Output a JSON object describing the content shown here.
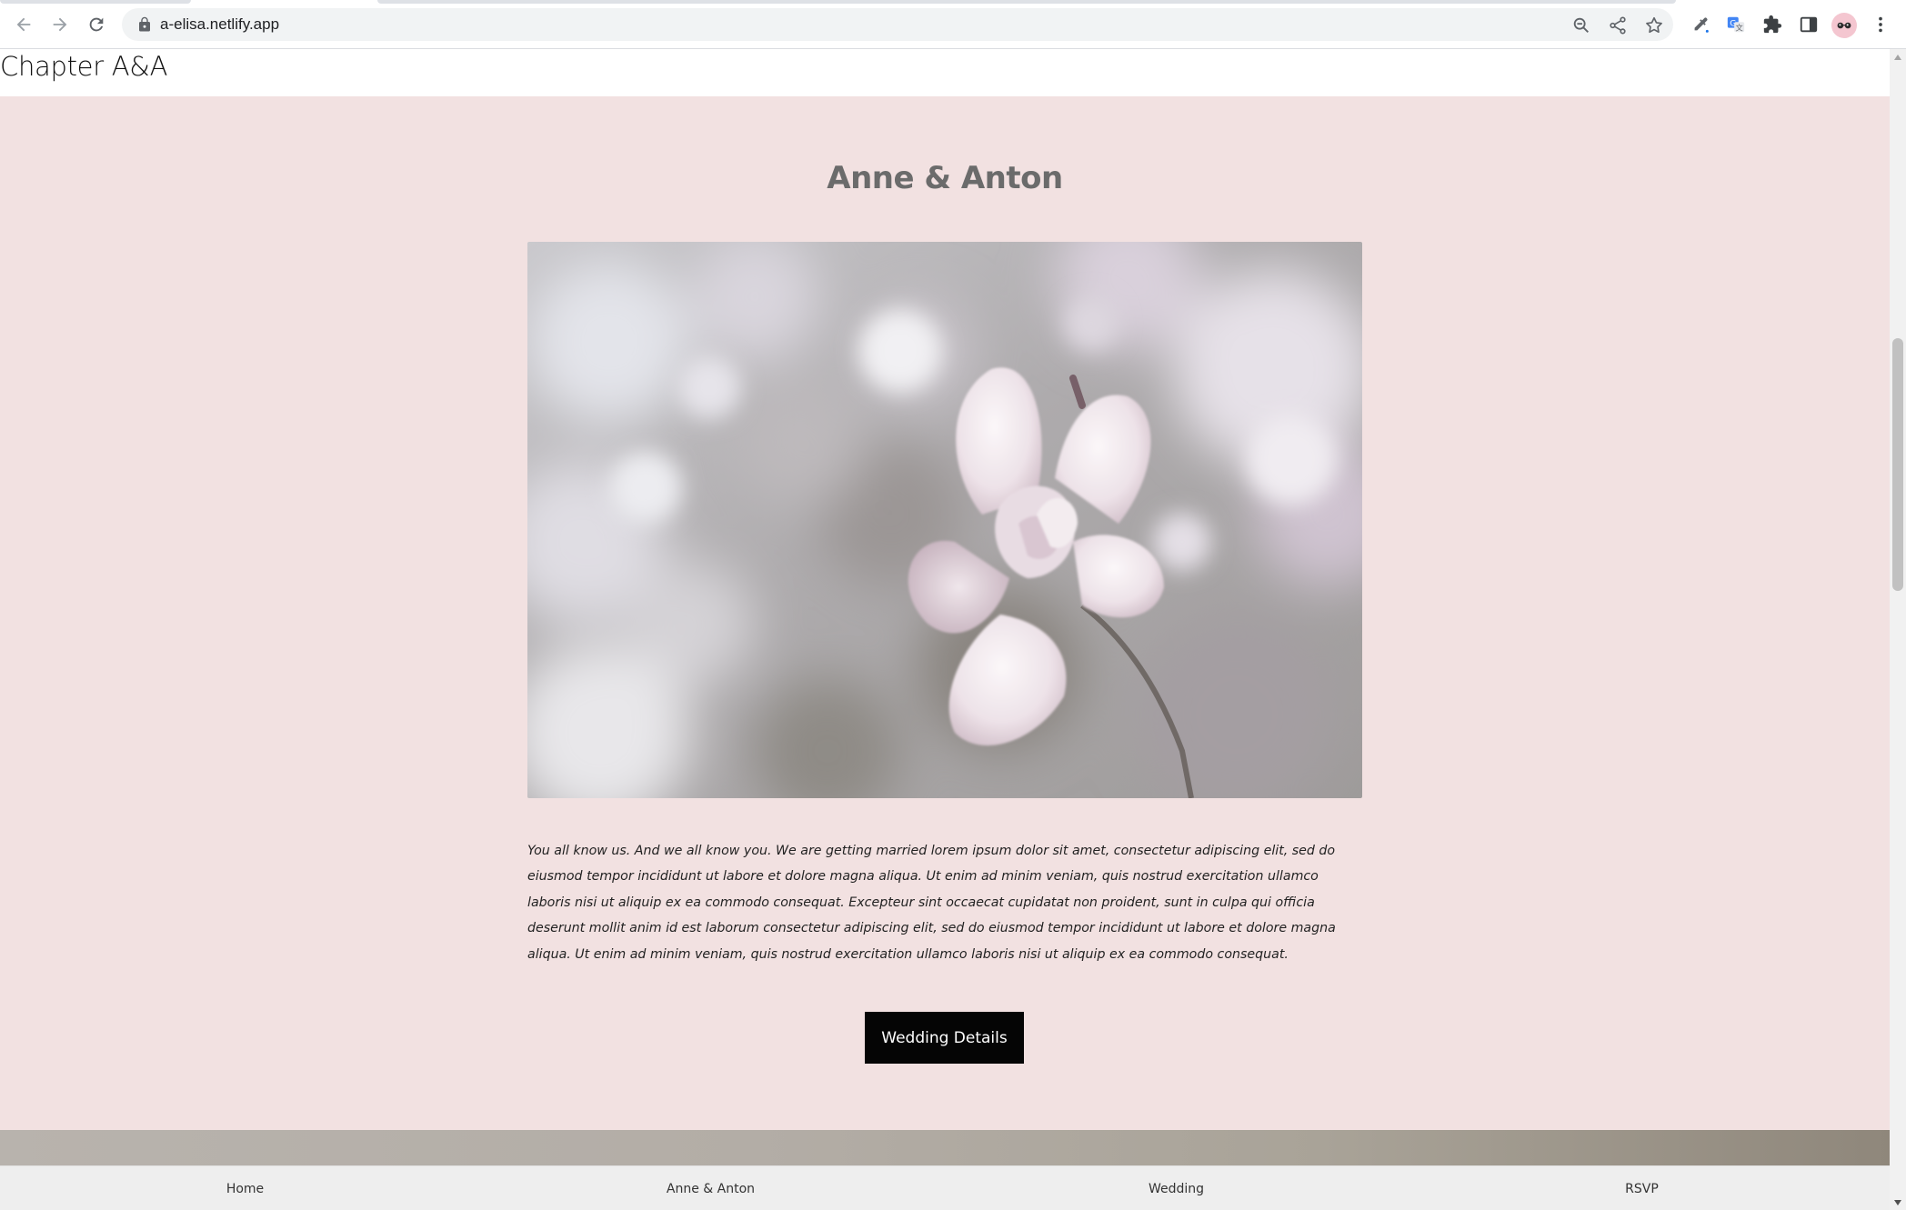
{
  "browser": {
    "url": "a-elisa.netlify.app",
    "icons": {
      "back": "back-arrow-icon",
      "forward": "forward-arrow-icon",
      "reload": "reload-icon",
      "lock": "lock-icon",
      "zoom": "zoom-icon",
      "share": "share-icon",
      "bookmark": "star-icon",
      "eyedropper": "eyedropper-icon",
      "translate": "translate-icon",
      "extensions": "puzzle-icon",
      "side_panel": "side-panel-icon",
      "profile": "profile-avatar-icon",
      "menu": "kebab-menu-icon"
    }
  },
  "site": {
    "title": "Chapter A&A"
  },
  "main": {
    "heading": "Anne & Anton",
    "intro_text": "You all know us. And we all know you. We are getting married lorem ipsum dolor sit amet, consectetur adipiscing elit, sed do eiusmod tempor incididunt ut labore et dolore magna aliqua. Ut enim ad minim veniam, quis nostrud exercitation ullamco laboris nisi ut aliquip ex ea commodo consequat. Excepteur sint occaecat cupidatat non proident, sunt in culpa qui officia deserunt mollit anim id est laborum consectetur adipiscing elit, sed do eiusmod tempor incididunt ut labore et dolore magna aliqua. Ut enim ad minim veniam, quis nostrud exercitation ullamco laboris nisi ut aliquip ex ea commodo consequat.",
    "cta_label": "Wedding Details"
  },
  "bottom_nav": {
    "items": [
      {
        "label": "Home"
      },
      {
        "label": "Anne & Anton"
      },
      {
        "label": "Wedding"
      },
      {
        "label": "RSVP"
      }
    ]
  },
  "colors": {
    "page_background": "#f2e1e1",
    "heading": "#6b6b6b",
    "button": "#050505",
    "bottom_nav": "#eeeeee"
  }
}
